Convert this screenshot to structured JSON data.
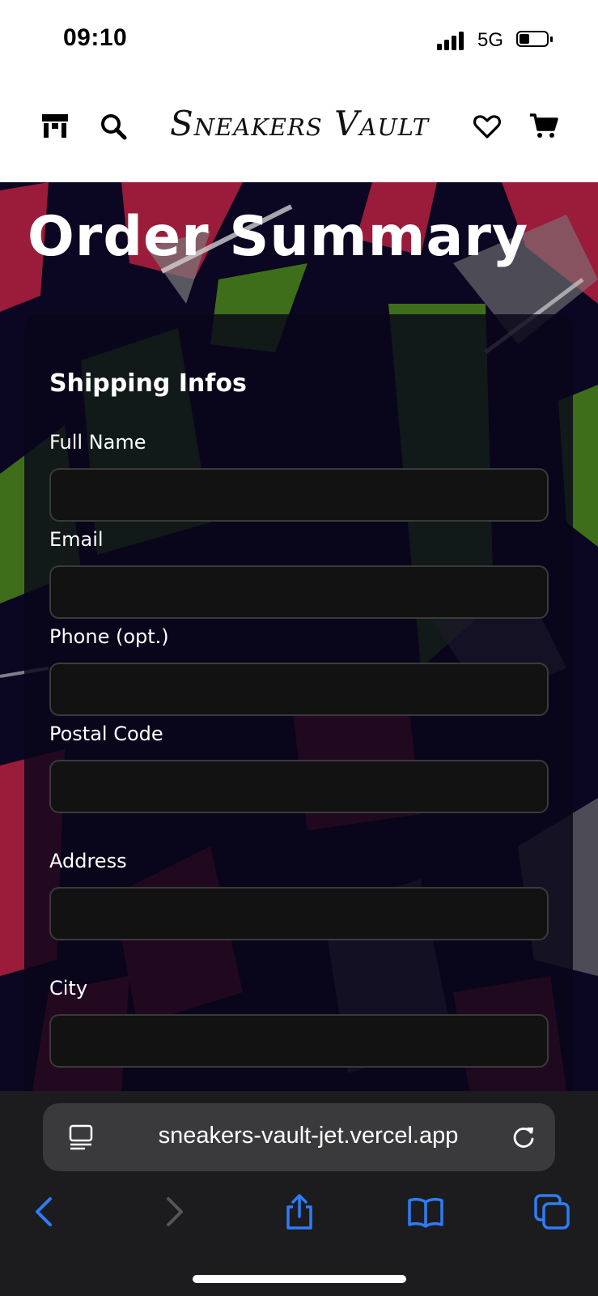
{
  "status_bar": {
    "time": "09:10",
    "network": "5G",
    "signal_icon": "signal-bars-icon",
    "battery_icon": "battery-icon"
  },
  "header": {
    "brand": "Sneakers Vault",
    "icons": [
      "store-icon",
      "search-icon",
      "heart-icon",
      "cart-icon"
    ]
  },
  "page": {
    "title": "Order Summary"
  },
  "shipping_form": {
    "section_title": "Shipping Infos",
    "fields": [
      {
        "label": "Full Name",
        "value": "",
        "placeholder": ""
      },
      {
        "label": "Email",
        "value": "",
        "placeholder": ""
      },
      {
        "label": "Phone (opt.)",
        "value": "",
        "placeholder": ""
      },
      {
        "label": "Postal Code",
        "value": "",
        "placeholder": ""
      },
      {
        "label": "Address",
        "value": "",
        "placeholder": ""
      },
      {
        "label": "City",
        "value": "",
        "placeholder": ""
      }
    ]
  },
  "browser": {
    "url": "sneakers-vault-jet.vercel.app",
    "toolbar_icons": [
      "back-icon",
      "forward-icon",
      "share-icon",
      "bookmarks-icon",
      "tabs-icon"
    ]
  },
  "colors": {
    "accent_blue": "#2f7cf6",
    "background_navy": "#0b0622",
    "art_crimson": "#9b1b3a",
    "art_green": "#3f6e1a",
    "art_gray": "#7a7a7a"
  }
}
